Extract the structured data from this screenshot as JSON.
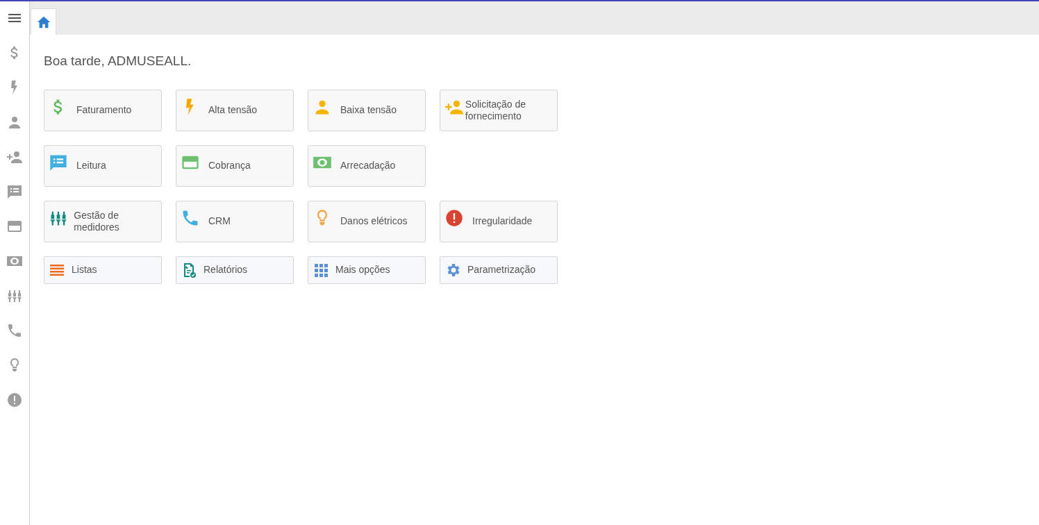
{
  "sidebar": {
    "items": [
      {
        "kind": "menu"
      },
      {
        "kind": "dollar"
      },
      {
        "kind": "bolt"
      },
      {
        "kind": "person"
      },
      {
        "kind": "person-add"
      },
      {
        "kind": "list-chat"
      },
      {
        "kind": "card"
      },
      {
        "kind": "money"
      },
      {
        "kind": "meters"
      },
      {
        "kind": "phone"
      },
      {
        "kind": "bulb"
      },
      {
        "kind": "alert"
      }
    ]
  },
  "tabs": [
    {
      "kind": "home",
      "selected": true
    }
  ],
  "greeting": "Boa tarde, ADMUSEALL.",
  "rows": [
    {
      "kind": "tall",
      "tiles": [
        {
          "kind": "dollar",
          "label": "Faturamento"
        },
        {
          "kind": "bolt",
          "label": "Alta tensão"
        },
        {
          "kind": "person",
          "label": "Baixa tensão"
        },
        {
          "kind": "person-add",
          "label": "Solicitação de fornecimento"
        }
      ]
    },
    {
      "kind": "tall",
      "tiles": [
        {
          "kind": "list-chat",
          "label": "Leitura"
        },
        {
          "kind": "card",
          "label": "Cobrança"
        },
        {
          "kind": "money",
          "label": "Arrecadação"
        }
      ]
    },
    {
      "kind": "tall",
      "tiles": [
        {
          "kind": "meters",
          "label": "Gestão de medidores"
        },
        {
          "kind": "phone",
          "label": "CRM"
        },
        {
          "kind": "bulb",
          "label": "Danos elétricos"
        },
        {
          "kind": "alert",
          "label": "Irregularidade"
        }
      ]
    },
    {
      "kind": "short",
      "tiles": [
        {
          "kind": "lines",
          "label": "Listas"
        },
        {
          "kind": "report",
          "label": "Relatórios"
        },
        {
          "kind": "grid",
          "label": "Mais opções"
        },
        {
          "kind": "gear",
          "label": "Parametrização"
        }
      ]
    }
  ]
}
